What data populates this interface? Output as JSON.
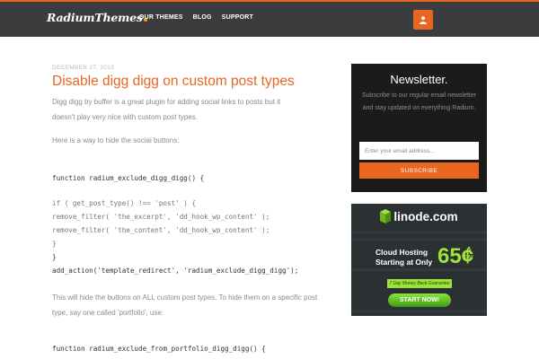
{
  "header": {
    "logo_text": "RadiumThemes",
    "nav": [
      "OUR THEMES",
      "BLOG",
      "SUPPORT"
    ],
    "user_icon": "user-icon"
  },
  "post": {
    "date": "DECEMBER 27, 2013",
    "title": "Disable digg digg on custom post types",
    "intro": "Digg digg by buffer is a great plugin for adding social links to posts but it doesn't play very nice with custom post types.",
    "howto": "Here is a way to hide the social buttons:",
    "code1": [
      "function radium_exclude_digg_digg() {",
      "if ( get_post_type() !== 'post' ) {",
      "remove_filter( 'the_excerpt', 'dd_hook_wp_content' );",
      "remove_filter( 'the_content', 'dd_hook_wp_content' );",
      "}",
      "}",
      "add_action('template_redirect', 'radium_exclude_digg_digg');"
    ],
    "after": "This will hide the buttons on ALL custom post types. To hide them on a specific post type, say one called 'portfolio', use:",
    "code2": "function radium_exclude_from_portfolio_digg_digg() {"
  },
  "newsletter": {
    "title": "Newsletter.",
    "text": "Subscribe to our regular email newsletter and stay updated on everything Radium.",
    "placeholder": "Enter your email address...",
    "button": "SUBSCRIBE"
  },
  "ad": {
    "brand": "linode.com",
    "line1": "Cloud Hosting",
    "line2": "Starting at Only",
    "price": "65¢",
    "a": "A",
    "day": "DAY",
    "guarantee": "7 Day Money Back Guarantee",
    "cta": "START NOW!",
    "accent": "#9fe23a"
  },
  "colors": {
    "accent": "#e8661f",
    "header_bg": "#3a3c3e"
  }
}
